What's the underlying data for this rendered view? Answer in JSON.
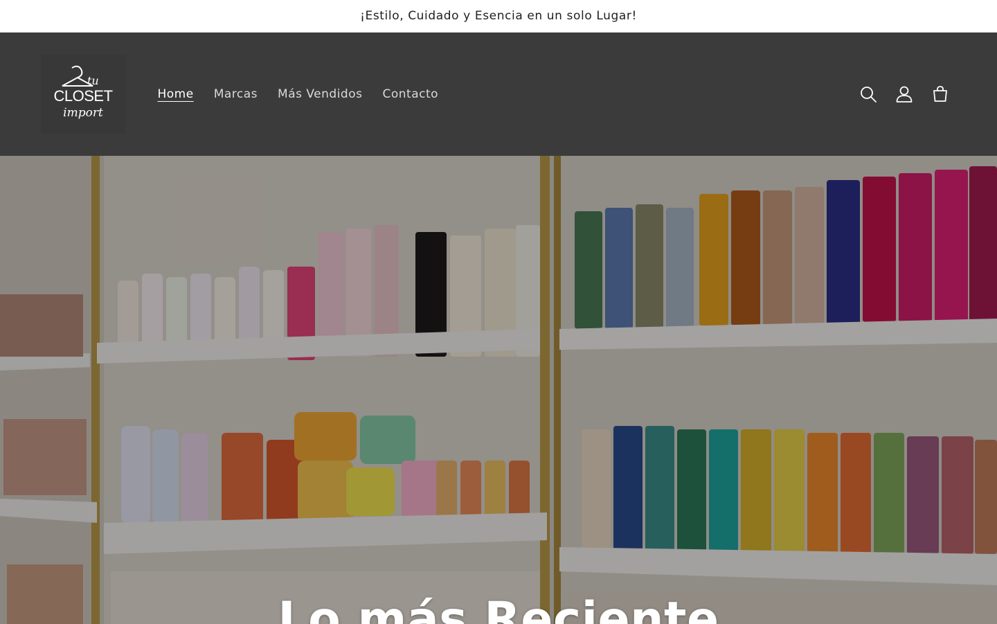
{
  "announcement": {
    "text": "¡Estilo, Cuidado y Esencia en un solo Lugar!"
  },
  "header": {
    "logo": {
      "line1": "tu",
      "line2": "CLOSET",
      "line3": "import"
    },
    "nav": [
      {
        "label": "Home",
        "active": true
      },
      {
        "label": "Marcas"
      },
      {
        "label": "Más Vendidos"
      },
      {
        "label": "Contacto"
      }
    ],
    "icons": [
      "search-icon",
      "account-icon",
      "cart-icon"
    ]
  },
  "hero": {
    "title": "Lo más Reciente"
  },
  "colors": {
    "header_bg": "#3b3b3b",
    "announcement_bg": "#ffffff",
    "shelf_frame": "#b99a4a"
  }
}
